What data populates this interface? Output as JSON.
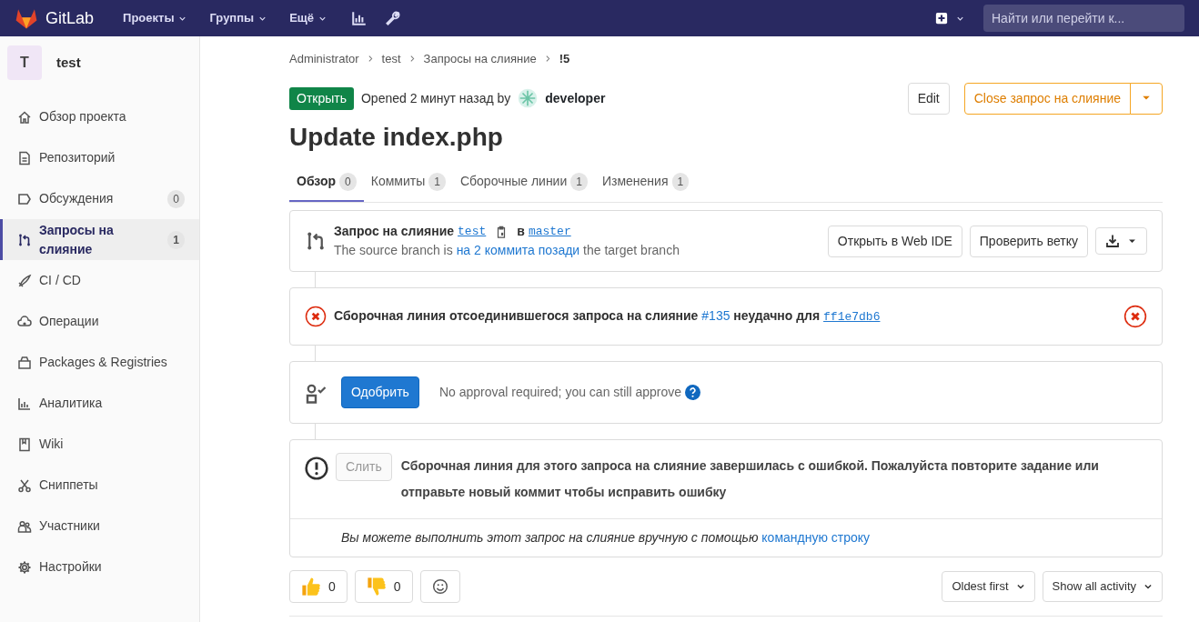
{
  "navbar": {
    "brand": "GitLab",
    "menus": [
      {
        "label": "Проекты"
      },
      {
        "label": "Группы"
      },
      {
        "label": "Ещё"
      }
    ],
    "search": {
      "placeholder": "Найти или перейти к..."
    }
  },
  "sidebar": {
    "project": {
      "avatar": "T",
      "name": "test"
    },
    "items": [
      {
        "label": "Обзор проекта",
        "selected": false
      },
      {
        "label": "Репозиторий",
        "selected": false
      },
      {
        "label": "Обсуждения",
        "selected": false,
        "count": "0"
      },
      {
        "label": "Запросы на слияние",
        "selected": true,
        "count": "1"
      },
      {
        "label": "CI / CD",
        "selected": false
      },
      {
        "label": "Операции",
        "selected": false
      },
      {
        "label": "Packages & Registries",
        "selected": false
      },
      {
        "label": "Аналитика",
        "selected": false
      },
      {
        "label": "Wiki",
        "selected": false
      },
      {
        "label": "Сниппеты",
        "selected": false
      },
      {
        "label": "Участники",
        "selected": false
      },
      {
        "label": "Настройки",
        "selected": false
      }
    ]
  },
  "breadcrumb": [
    "Administrator",
    "test",
    "Запросы на слияние",
    "!5"
  ],
  "header": {
    "status": "Открыть",
    "meta": "Opened 2 минут назад by",
    "author": "developer",
    "edit": "Edit",
    "close": "Close запрос на слияние"
  },
  "title": "Update index.php",
  "tabs": [
    {
      "label": "Обзор",
      "count": "0",
      "selected": true
    },
    {
      "label": "Коммиты",
      "count": "1",
      "selected": false
    },
    {
      "label": "Сборочные линии",
      "count": "1",
      "selected": false
    },
    {
      "label": "Изменения",
      "count": "1",
      "selected": false
    }
  ],
  "mr_widget": {
    "prefix": "Запрос на слияние",
    "source": "test",
    "connector": "в",
    "target": "master",
    "behind_before": "The source branch is",
    "behind_link": "на 2 коммита позади",
    "behind_after": "the target branch",
    "buttons": [
      "Открыть в Web IDE",
      "Проверить ветку"
    ]
  },
  "pipeline": {
    "text": "Сборочная линия отсоединившегося запроса на слияние",
    "link": "#135",
    "text2": "неудачно для",
    "commit": "ff1e7db6"
  },
  "approval": {
    "button": "Одобрить",
    "text": "No approval required; you can still approve"
  },
  "merge": {
    "button": "Слить",
    "disabled": true,
    "message": "Сборочная линия для этого запроса на слияние завершилась с ошибкой. Пожалуйста повторите задание или отправьте новый коммит чтобы исправить ошибку",
    "footer": "Вы можете выполнить этот запрос на слияние вручную с помощью",
    "footer_link": "командную строку"
  },
  "reactions": [
    {
      "kind": "thumbsup",
      "count": "0"
    },
    {
      "kind": "thumbsdown",
      "count": "0"
    }
  ],
  "sort": [
    "Oldest first",
    "Show all activity"
  ]
}
